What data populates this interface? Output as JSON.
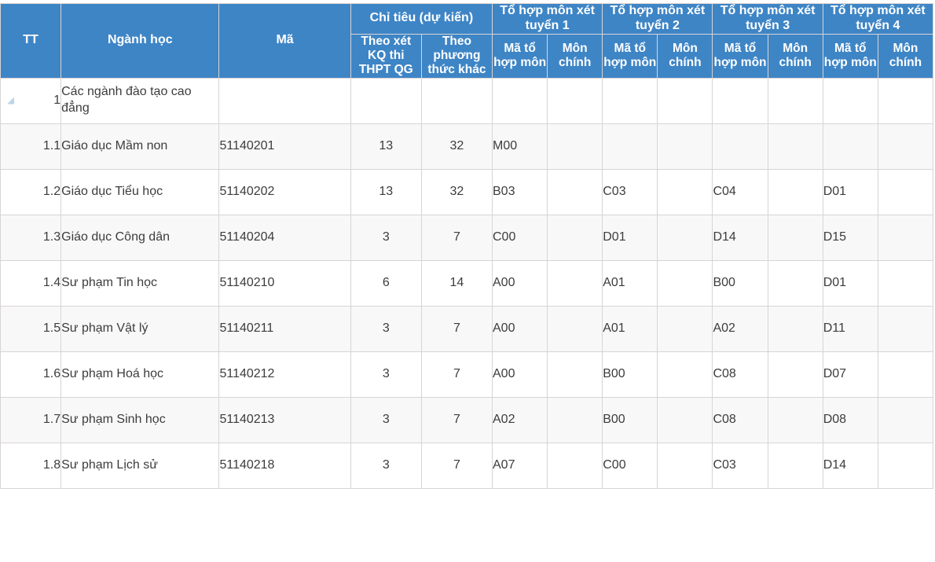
{
  "table": {
    "header": {
      "row1": [
        {
          "label": "TT",
          "rowspan": 2
        },
        {
          "label": "Ngành học",
          "rowspan": 2
        },
        {
          "label": "Mã",
          "rowspan": 2
        },
        {
          "label": "Chỉ tiêu (dự kiến)",
          "colspan": 2
        },
        {
          "label": "Tổ hợp môn xét tuyển 1",
          "colspan": 2
        },
        {
          "label": "Tổ hợp môn xét tuyển 2",
          "colspan": 2
        },
        {
          "label": "Tổ hợp môn xét tuyển 3",
          "colspan": 2
        },
        {
          "label": "Tổ hợp môn xét tuyển 4",
          "colspan": 2
        }
      ],
      "row2": [
        "Theo xét KQ thi THPT QG",
        "Theo phương thức khác",
        "Mã tổ hợp môn",
        "Môn chính",
        "Mã tổ hợp môn",
        "Môn chính",
        "Mã tổ hợp môn",
        "Môn chính",
        "Mã tổ hợp môn",
        "Môn chính"
      ]
    },
    "rows": [
      {
        "tt": "1",
        "name": "Các ngành đào tạo cao đẳng",
        "ma": "",
        "kq": "",
        "pt": "",
        "c1": "",
        "m1": "",
        "c2": "",
        "m2": "",
        "c3": "",
        "m3": "",
        "c4": "",
        "m4": "",
        "group": true,
        "collapse_icon": "collapse-triangle-icon"
      },
      {
        "tt": "1.1",
        "name": "Giáo dục Mầm non",
        "ma": "51140201",
        "kq": "13",
        "pt": "32",
        "c1": "M00",
        "m1": "",
        "c2": "",
        "m2": "",
        "c3": "",
        "m3": "",
        "c4": "",
        "m4": "",
        "group": false
      },
      {
        "tt": "1.2",
        "name": "Giáo dục Tiểu học",
        "ma": "51140202",
        "kq": "13",
        "pt": "32",
        "c1": "B03",
        "m1": "",
        "c2": "C03",
        "m2": "",
        "c3": "C04",
        "m3": "",
        "c4": "D01",
        "m4": "",
        "group": false
      },
      {
        "tt": "1.3",
        "name": "Giáo dục Công dân",
        "ma": "51140204",
        "kq": "3",
        "pt": "7",
        "c1": "C00",
        "m1": "",
        "c2": "D01",
        "m2": "",
        "c3": "D14",
        "m3": "",
        "c4": "D15",
        "m4": "",
        "group": false
      },
      {
        "tt": "1.4",
        "name": "Sư phạm Tin học",
        "ma": "51140210",
        "kq": "6",
        "pt": "14",
        "c1": "A00",
        "m1": "",
        "c2": "A01",
        "m2": "",
        "c3": "B00",
        "m3": "",
        "c4": "D01",
        "m4": "",
        "group": false
      },
      {
        "tt": "1.5",
        "name": "Sư phạm Vật lý",
        "ma": "51140211",
        "kq": "3",
        "pt": "7",
        "c1": "A00",
        "m1": "",
        "c2": "A01",
        "m2": "",
        "c3": "A02",
        "m3": "",
        "c4": "D11",
        "m4": "",
        "group": false
      },
      {
        "tt": "1.6",
        "name": "Sư phạm Hoá học",
        "ma": "51140212",
        "kq": "3",
        "pt": "7",
        "c1": "A00",
        "m1": "",
        "c2": "B00",
        "m2": "",
        "c3": "C08",
        "m3": "",
        "c4": "D07",
        "m4": "",
        "group": false
      },
      {
        "tt": "1.7",
        "name": "Sư phạm Sinh học",
        "ma": "51140213",
        "kq": "3",
        "pt": "7",
        "c1": "A02",
        "m1": "",
        "c2": "B00",
        "m2": "",
        "c3": "C08",
        "m3": "",
        "c4": "D08",
        "m4": "",
        "group": false
      },
      {
        "tt": "1.8",
        "name": "Sư phạm Lịch sử",
        "ma": "51140218",
        "kq": "3",
        "pt": "7",
        "c1": "A07",
        "m1": "",
        "c2": "C00",
        "m2": "",
        "c3": "C03",
        "m3": "",
        "c4": "D14",
        "m4": "",
        "group": false
      }
    ]
  },
  "colors": {
    "header_blue": "#3E85C6",
    "header_text": "#ffffff",
    "grid_line": "#d8d4d4",
    "row_alt": "#f8f8f8",
    "collapse_icon": "#bcd4ea"
  }
}
